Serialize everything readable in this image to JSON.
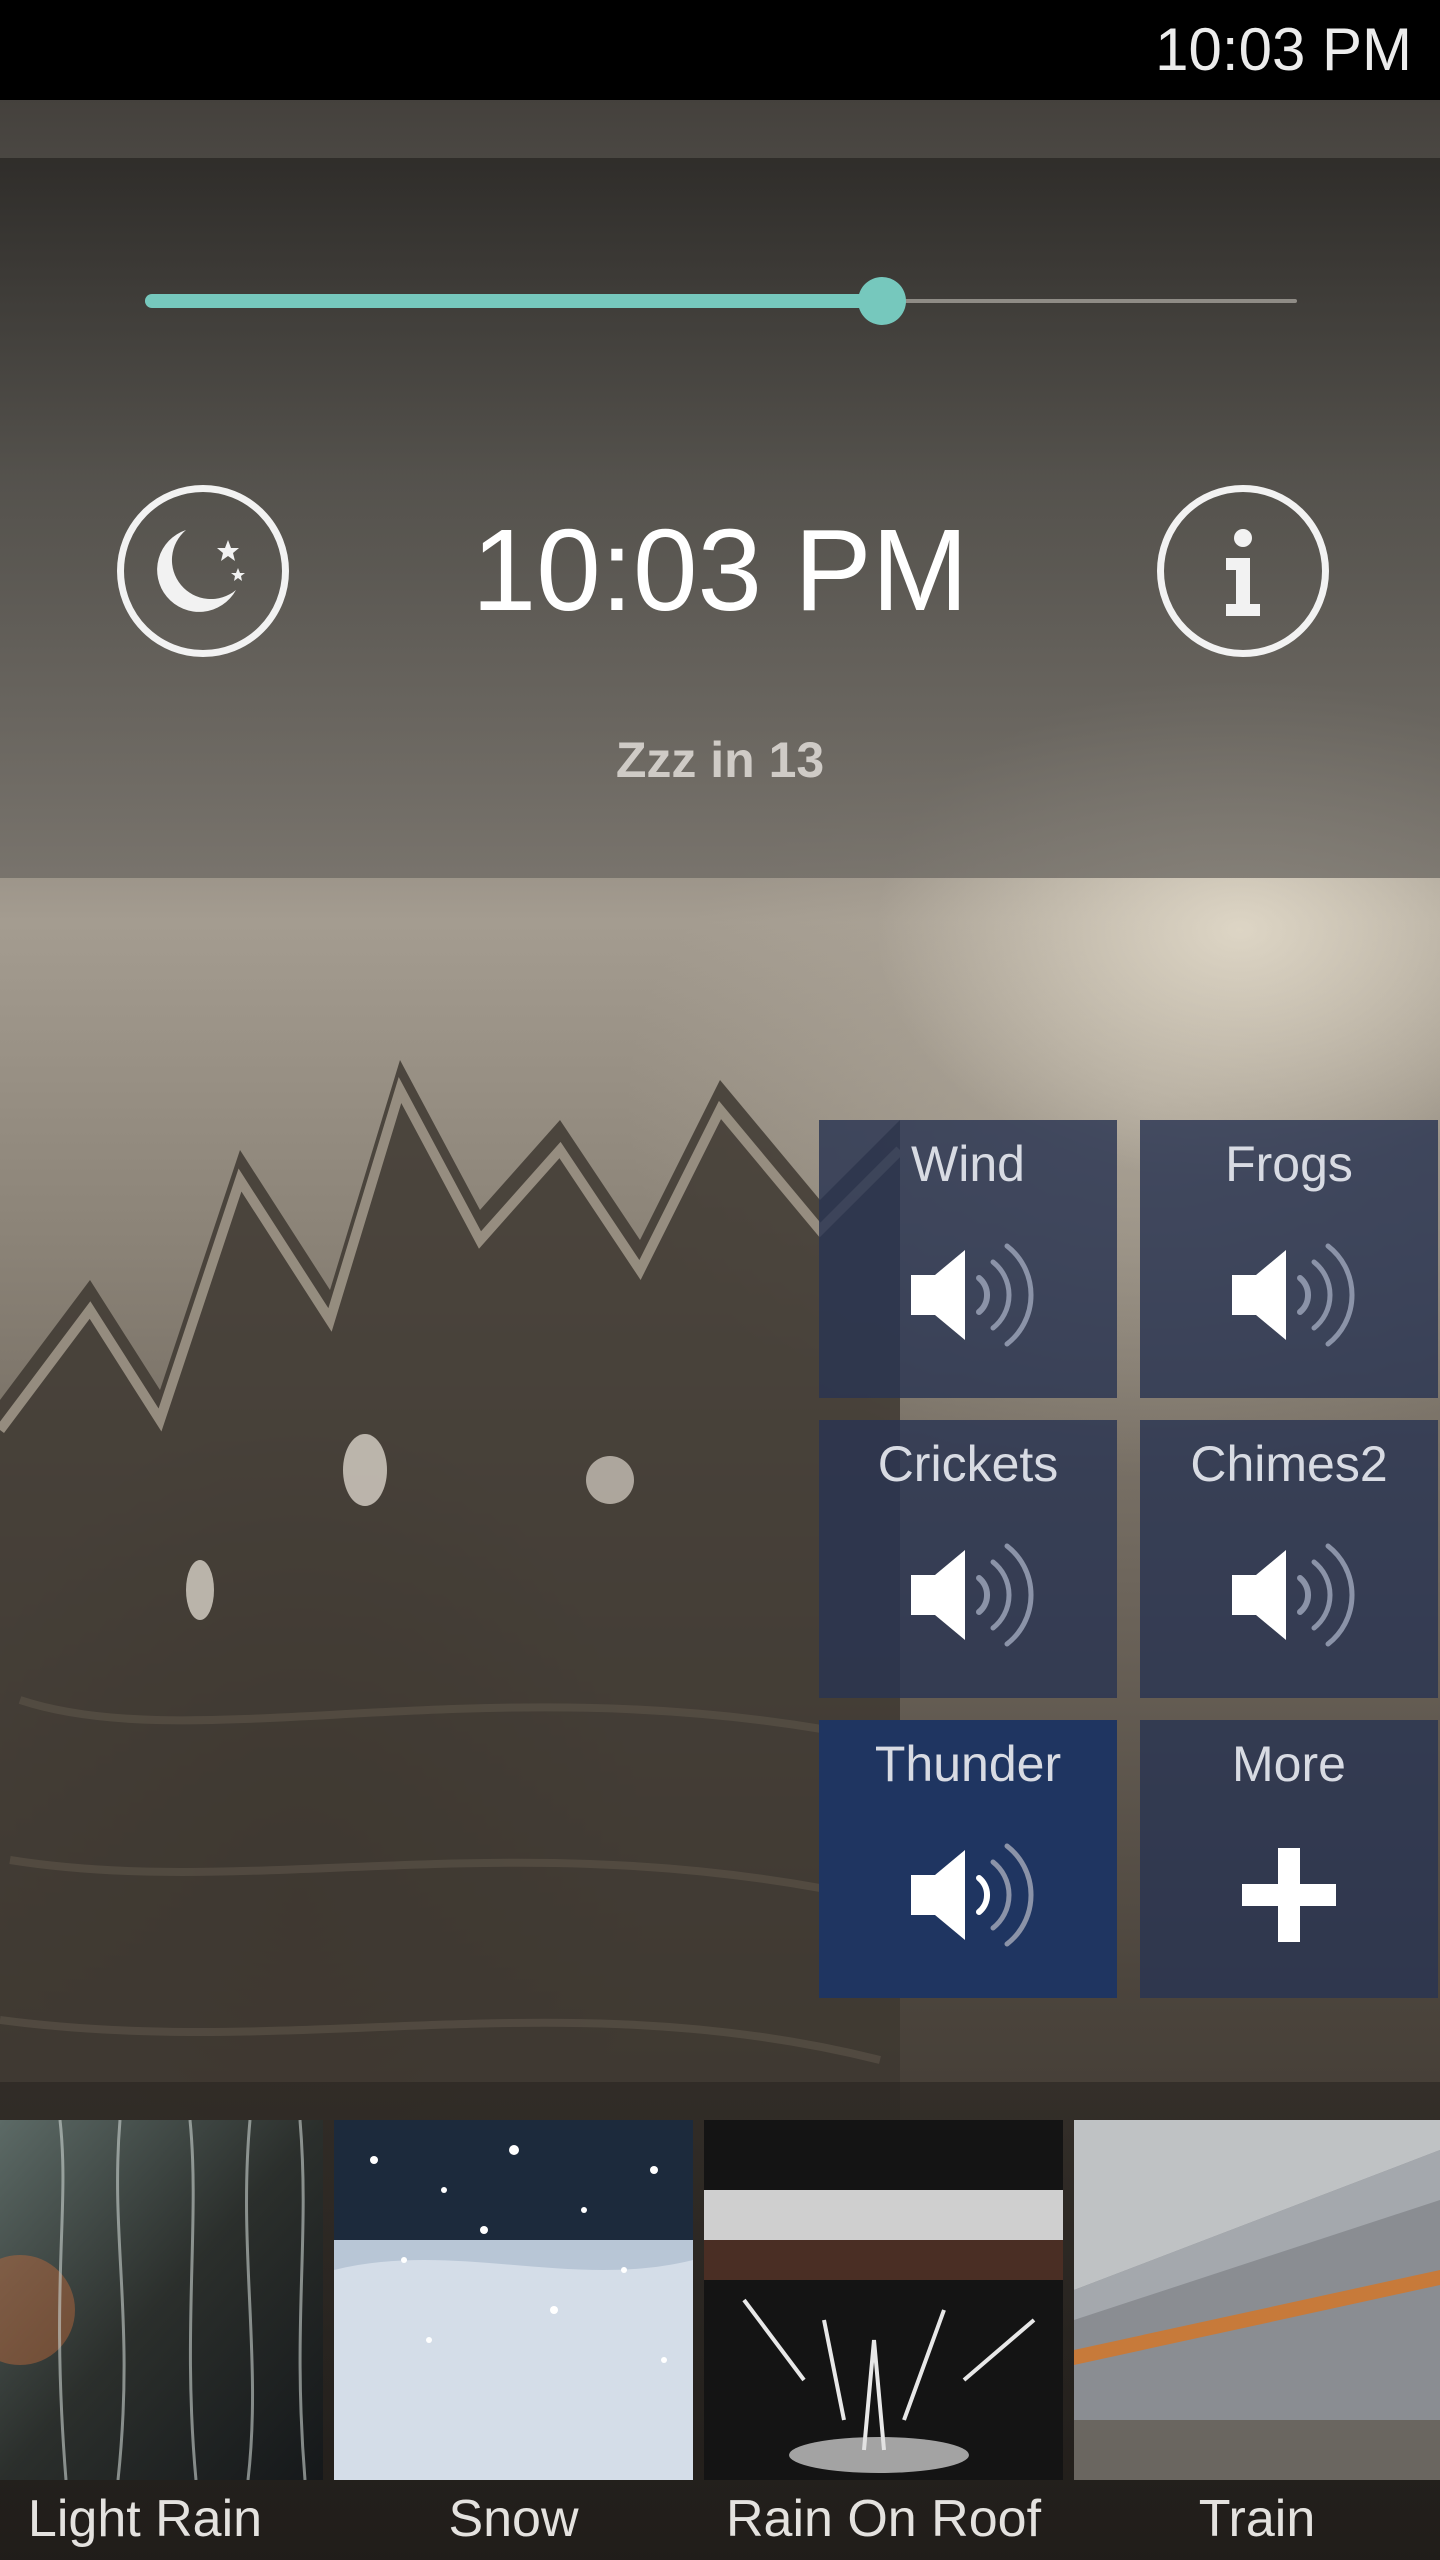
{
  "status_bar": {
    "time": "10:03 PM"
  },
  "timer": {
    "slider_fraction": 0.64,
    "clock": "10:03 PM",
    "sleep_label": "Zzz in 13"
  },
  "icons": {
    "moon": "moon-stars-icon",
    "info": "info-icon",
    "speaker": "speaker-icon",
    "plus": "plus-icon"
  },
  "mix_tiles": [
    {
      "label": "Wind",
      "icon": "speaker-icon",
      "active": false
    },
    {
      "label": "Frogs",
      "icon": "speaker-icon",
      "active": false
    },
    {
      "label": "Crickets",
      "icon": "speaker-icon",
      "active": false
    },
    {
      "label": "Chimes2",
      "icon": "speaker-icon",
      "active": false
    },
    {
      "label": "Thunder",
      "icon": "speaker-icon",
      "active": true
    },
    {
      "label": "More",
      "icon": "plus-icon",
      "active": false
    }
  ],
  "sounds": [
    {
      "label": "Light Rain"
    },
    {
      "label": "Snow"
    },
    {
      "label": "Rain On Roof"
    },
    {
      "label": "Train"
    }
  ],
  "colors": {
    "accent": "#76c8bd",
    "tile": "#2a3452",
    "tile_active": "#1f3561"
  }
}
